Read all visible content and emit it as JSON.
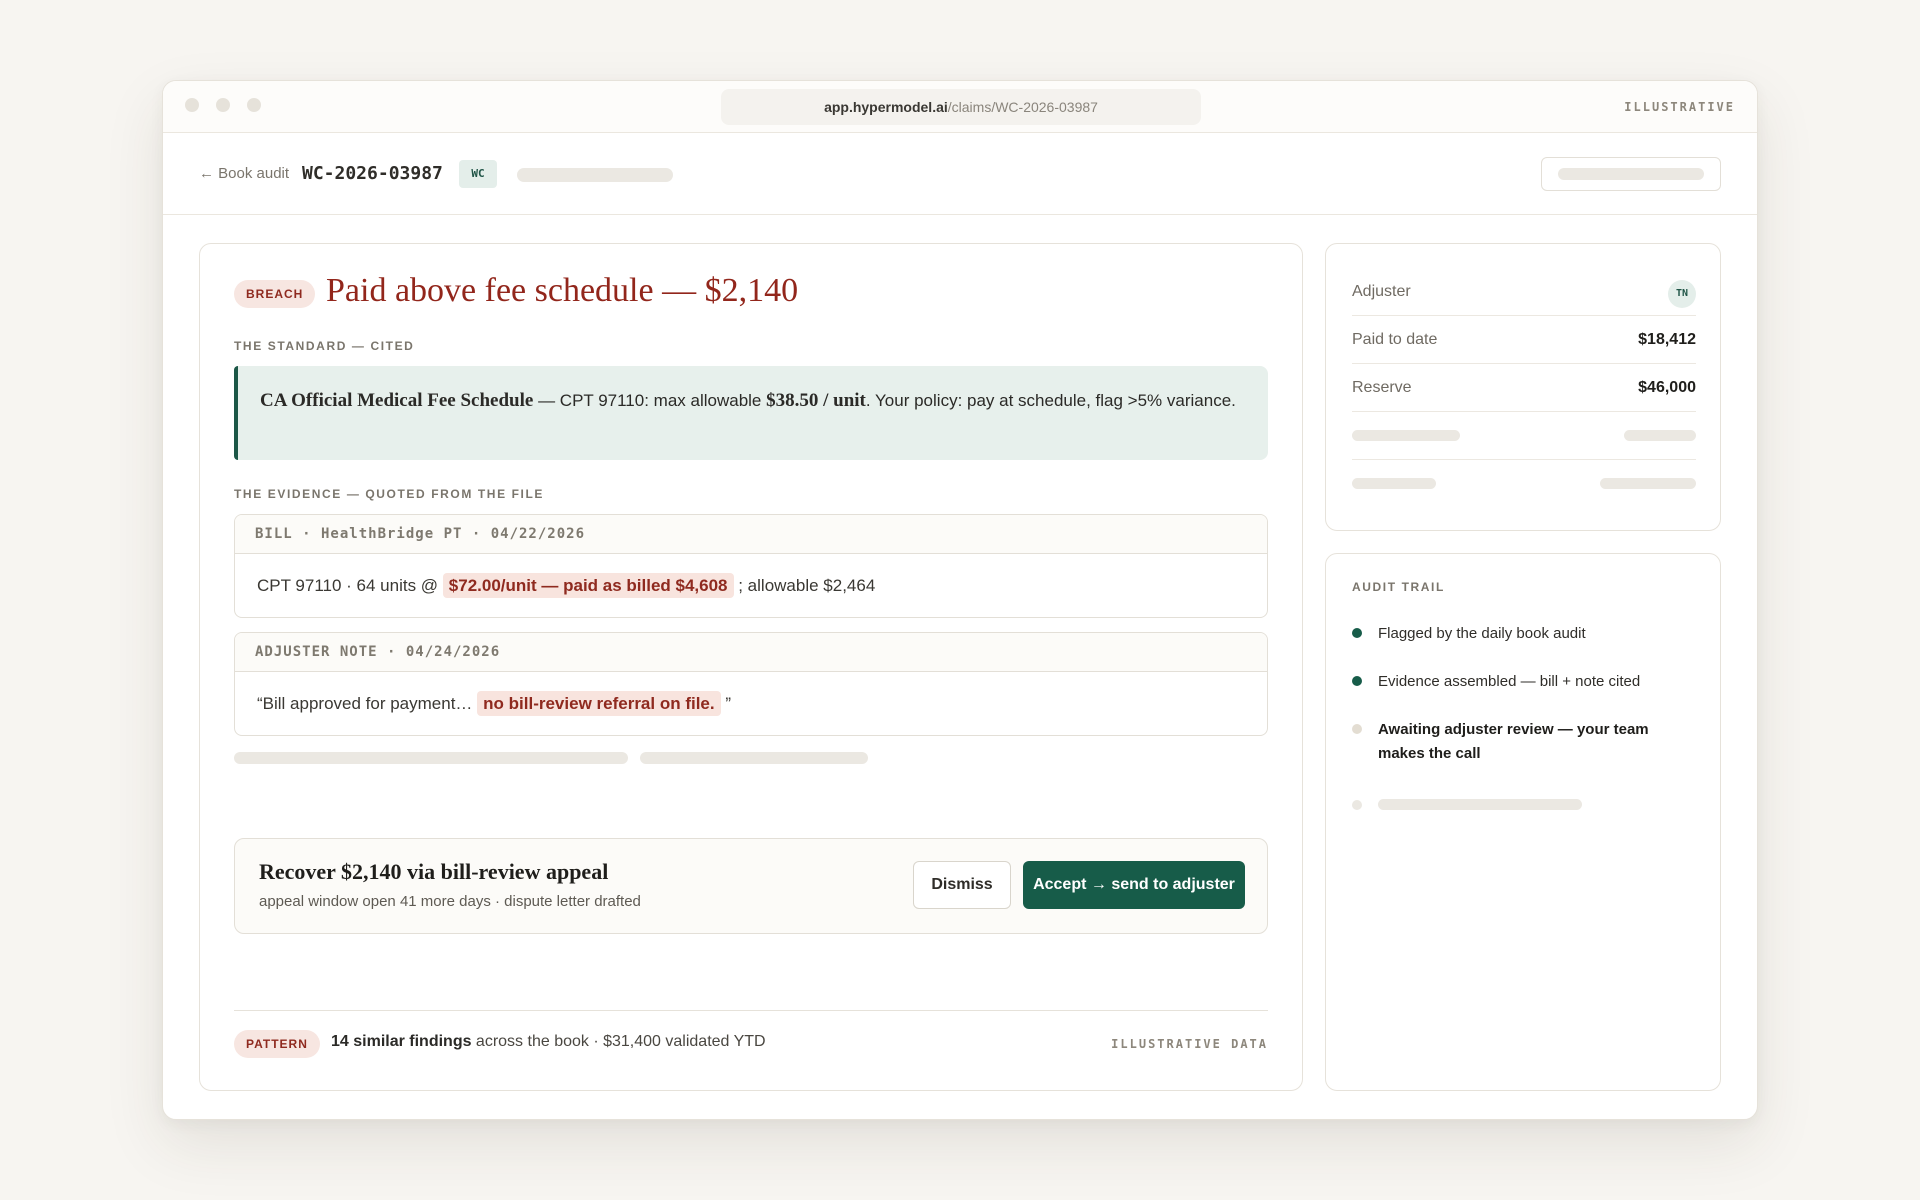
{
  "browser": {
    "url_host": "app.hypermodel.ai",
    "url_path": "/claims/WC-2026-03987",
    "tag": "ILLUSTRATIVE"
  },
  "header": {
    "back_label": "← Book audit",
    "claim_id": "WC-2026-03987",
    "claim_type": "WC"
  },
  "finding": {
    "badge": "BREACH",
    "title": "Paid above fee schedule — $2,140",
    "standard_label": "THE STANDARD — CITED",
    "standard": {
      "source": "CA Official Medical Fee Schedule",
      "text_a": " — CPT 97110: max allowable ",
      "max_allowable": "$38.50 / unit",
      "text_b": ". Your policy: pay at schedule, flag >5% variance."
    },
    "evidence_label": "THE EVIDENCE — QUOTED FROM THE FILE",
    "evidence": [
      {
        "header": "BILL · HealthBridge PT · 04/22/2026",
        "prefix": "CPT 97110 · 64 units @ ",
        "highlight": "$72.00/unit — paid as billed $4,608",
        "suffix": " ; allowable $2,464"
      },
      {
        "header": "ADJUSTER NOTE · 04/24/2026",
        "prefix": "“Bill approved for payment… ",
        "highlight": "no bill-review referral on file.",
        "suffix": " ”"
      }
    ],
    "recommendation": {
      "title": "Recover $2,140 via bill-review appeal",
      "subtitle": "appeal window open 41 more days · dispute letter drafted",
      "dismiss_label": "Dismiss",
      "accept_label": "Accept → send to adjuster"
    },
    "pattern": {
      "badge": "PATTERN",
      "count": "14 similar findings",
      "text": " across the book · $31,400 validated YTD",
      "tag": "ILLUSTRATIVE DATA"
    }
  },
  "claim_summary": {
    "adjuster_label": "Adjuster",
    "adjuster_initials": "TN",
    "paid_label": "Paid to date",
    "paid_value": "$18,412",
    "reserve_label": "Reserve",
    "reserve_value": "$46,000"
  },
  "audit_trail": {
    "label": "AUDIT TRAIL",
    "items": [
      {
        "text": "Flagged by the daily book audit",
        "status": "done"
      },
      {
        "text": "Evidence assembled — bill + note cited",
        "status": "done"
      },
      {
        "text": "Awaiting adjuster review — your team makes the call",
        "status": "pending"
      }
    ]
  },
  "colors": {
    "accent_green": "#175c49",
    "breach_red": "#92261b",
    "highlight_bg": "#f8e4de",
    "standard_bg": "#e7f0ec",
    "page_bg": "#f7f5f1"
  }
}
